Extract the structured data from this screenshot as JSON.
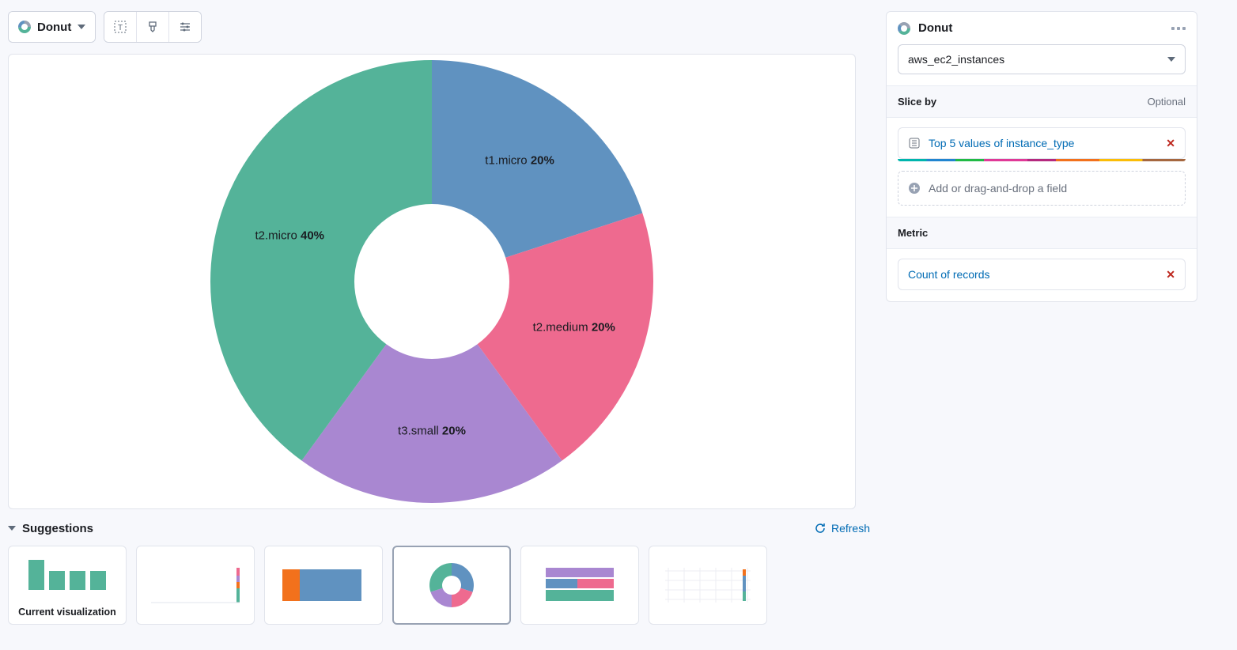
{
  "toolbar": {
    "chart_type_label": "Donut"
  },
  "right_panel": {
    "title": "Donut",
    "datasource_selected": "aws_ec2_instances",
    "slice_by": {
      "heading": "Slice by",
      "optional_label": "Optional",
      "pill_label": "Top 5 values of instance_type",
      "drop_placeholder": "Add or drag-and-drop a field"
    },
    "metric": {
      "heading": "Metric",
      "pill_label": "Count of records"
    }
  },
  "suggestions": {
    "heading": "Suggestions",
    "refresh_label": "Refresh",
    "current_label": "Current visualization"
  },
  "chart_data": {
    "type": "pie",
    "subtype": "donut",
    "slices": [
      {
        "label": "t2.micro",
        "percent": 40,
        "color": "#54b399"
      },
      {
        "label": "t1.micro",
        "percent": 20,
        "color": "#6092c0"
      },
      {
        "label": "t2.medium",
        "percent": 20,
        "color": "#ee6a8f"
      },
      {
        "label": "t3.small",
        "percent": 20,
        "color": "#a987d1"
      }
    ],
    "title": "",
    "inner_radius_ratio": 0.35
  }
}
